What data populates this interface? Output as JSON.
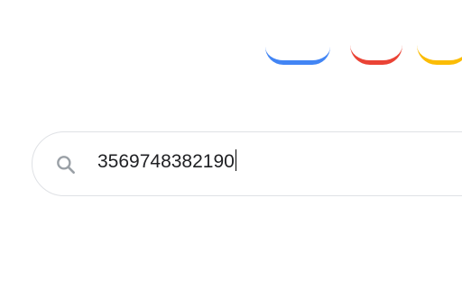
{
  "search": {
    "query": "3569748382190",
    "icon": "search-icon"
  },
  "logo": {
    "colors": [
      "#4285f4",
      "#ea4335",
      "#fbbc05"
    ]
  }
}
